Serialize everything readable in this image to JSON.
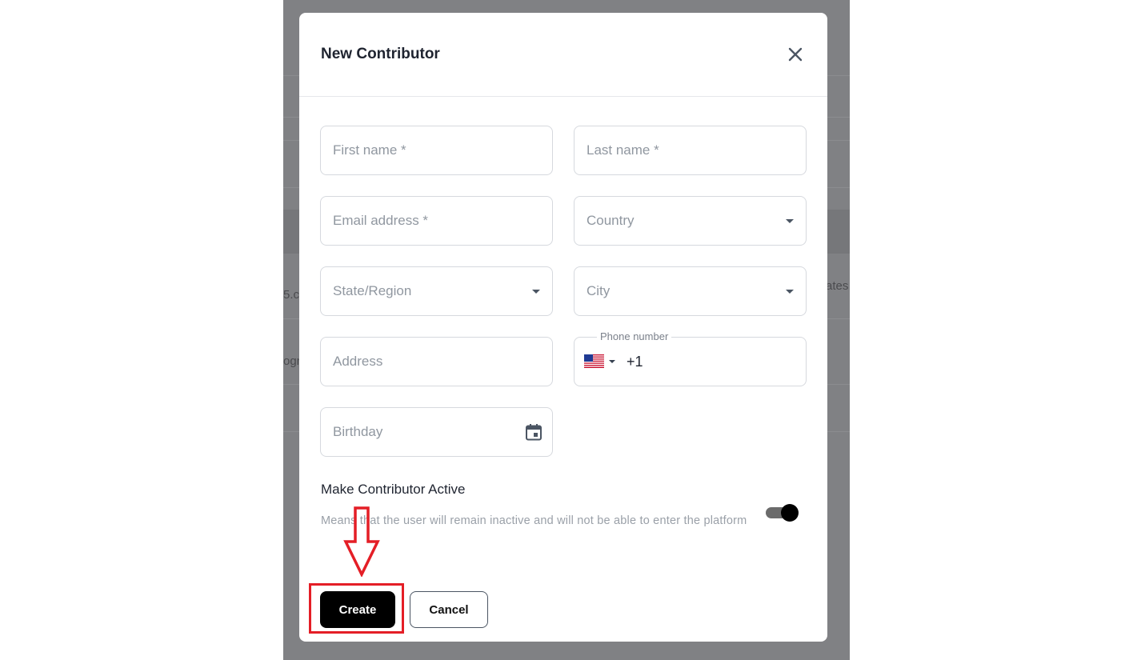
{
  "background": {
    "fragments": [
      "5.c",
      "ates",
      "ogn"
    ]
  },
  "modal": {
    "title": "New Contributor",
    "close_icon": "close-icon"
  },
  "form": {
    "first_name": {
      "placeholder": "First name *"
    },
    "last_name": {
      "placeholder": "Last name *"
    },
    "email": {
      "placeholder": "Email address *"
    },
    "country": {
      "placeholder": "Country"
    },
    "state": {
      "placeholder": "State/Region"
    },
    "city": {
      "placeholder": "City"
    },
    "address": {
      "placeholder": "Address"
    },
    "phone": {
      "label": "Phone number",
      "dial_code": "+1",
      "flag": "us-flag-icon"
    },
    "birthday": {
      "placeholder": "Birthday",
      "icon": "calendar-icon"
    }
  },
  "active_section": {
    "title": "Make Contributor Active",
    "description": "Means that the user will remain inactive and will not be able to enter the platform",
    "toggle_on": true
  },
  "buttons": {
    "create": "Create",
    "cancel": "Cancel"
  },
  "colors": {
    "overlay": "#808184",
    "primary_button": "#000000",
    "annotation": "#e41e26"
  }
}
